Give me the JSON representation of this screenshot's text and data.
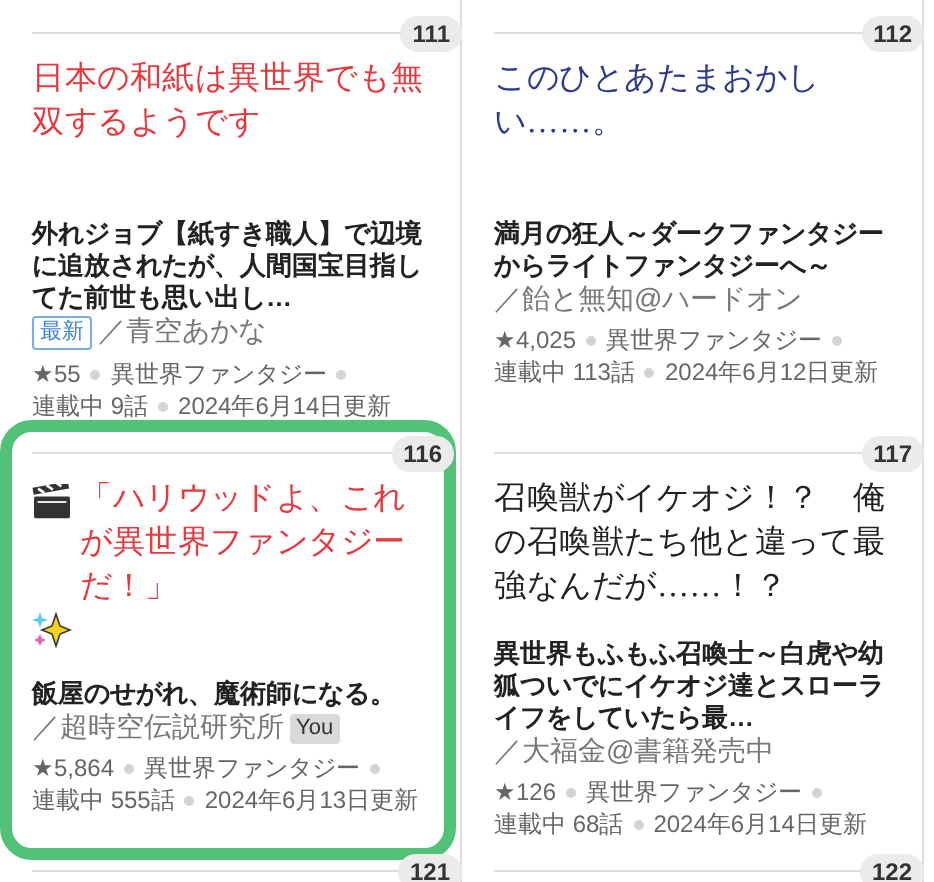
{
  "cards": [
    {
      "number": "111",
      "catch": {
        "text": "日本の和紙は異世界でも無双するようです",
        "color": "#e8383d"
      },
      "decorated": false,
      "highlighted": false,
      "title": "外れジョブ【紙すき職人】で辺境に追放されたが、人間国宝目指してた前世も思い出し…",
      "badge": {
        "kind": "new",
        "text": "最新"
      },
      "author": "／青空あかな",
      "stars": "★55",
      "genre": "異世界ファンタジー",
      "status": "連載中 9話",
      "updated": "2024年6月14日更新"
    },
    {
      "number": "112",
      "catch": {
        "text": "このひとあたまおかしい……。",
        "color": "#2b3a8f"
      },
      "decorated": false,
      "highlighted": false,
      "title": "満月の狂人～ダークファンタジーからライトファンタジーへ～",
      "author": "／飴と無知@ハードオン",
      "stars": "★4,025",
      "genre": "異世界ファンタジー",
      "status": "連載中 113話",
      "updated": "2024年6月12日更新"
    },
    {
      "number": "116",
      "catch": {
        "text": "「ハリウッドよ、これが異世界ファンタジーだ！」",
        "color": "#e8383d"
      },
      "decorated": true,
      "highlighted": true,
      "title": "飯屋のせがれ、魔術師になる。",
      "badge": {
        "kind": "you",
        "text": "You"
      },
      "author": "／超時空伝説研究所",
      "stars": "★5,864",
      "genre": "異世界ファンタジー",
      "status": "連載中 555話",
      "updated": "2024年6月13日更新"
    },
    {
      "number": "117",
      "catch": {
        "text": "召喚獣がイケオジ！？　俺の召喚獣たち他と違って最強なんだが……！？",
        "color": "#222222"
      },
      "decorated": false,
      "highlighted": false,
      "title": "異世界もふもふ召喚士～白虎や幼狐ついでにイケオジ達とスローライフをしていたら最…",
      "author": "／大福金@書籍発売中",
      "stars": "★126",
      "genre": "異世界ファンタジー",
      "status": "連載中 68話",
      "updated": "2024年6月14日更新"
    }
  ],
  "next_numbers": [
    "121",
    "122"
  ]
}
